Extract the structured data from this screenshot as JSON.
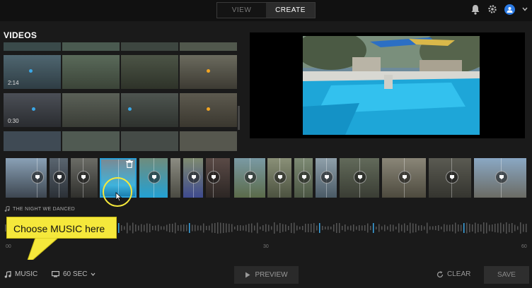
{
  "header": {
    "tabs": [
      {
        "label": "VIEW",
        "active": false
      },
      {
        "label": "CREATE",
        "active": true
      }
    ],
    "icons": [
      "bell-icon",
      "gear-icon",
      "user-icon",
      "chevron-down-icon"
    ]
  },
  "library": {
    "title": "VIDEOS",
    "durations": [
      "2:14",
      "0:30"
    ]
  },
  "music": {
    "song_title": "THE NIGHT WE DANCED",
    "timeline_ticks": [
      "00",
      "30",
      "60"
    ]
  },
  "callout": {
    "text": "Choose MUSIC here"
  },
  "toolbar": {
    "music_label": "MUSIC",
    "duration_label": "60 SEC",
    "preview_label": "PREVIEW",
    "clear_label": "CLEAR",
    "save_label": "SAVE"
  },
  "colors": {
    "accent": "#2aa0d8",
    "callout": "#f5e83b",
    "marker_blue": "#3ba7e6",
    "marker_orange": "#f3a522"
  }
}
